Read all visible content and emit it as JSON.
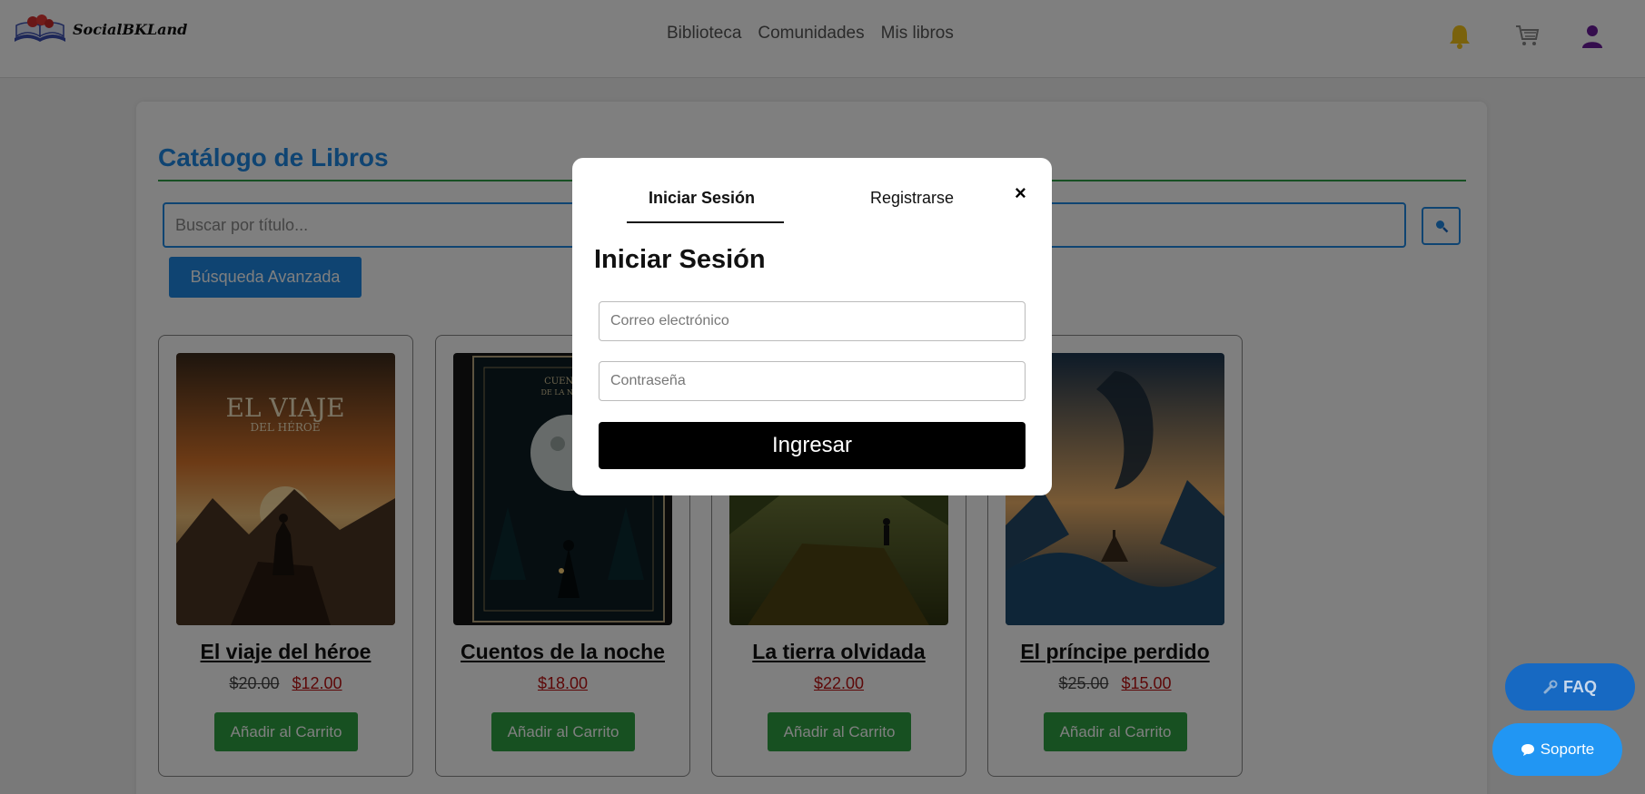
{
  "header": {
    "logo_text": "SocialBKLand",
    "nav": [
      "Biblioteca",
      "Comunidades",
      "Mis libros"
    ]
  },
  "catalog": {
    "title": "Catálogo de Libros",
    "search_placeholder": "Buscar por título...",
    "advanced_search_label": "Búsqueda Avanzada",
    "add_to_cart_label": "Añadir al Carrito"
  },
  "books": [
    {
      "title": "El viaje del héroe",
      "old_price": "$20.00",
      "price": "$12.00"
    },
    {
      "title": "Cuentos de la noche",
      "old_price": "",
      "price": "$18.00"
    },
    {
      "title": "La tierra olvidada",
      "old_price": "",
      "price": "$22.00"
    },
    {
      "title": "El príncipe perdido",
      "old_price": "$25.00",
      "price": "$15.00"
    }
  ],
  "covers": [
    {
      "cover_text": "EL VIAJE",
      "cover_subtext": "DEL HÉROE"
    },
    {
      "cover_text": "CUENTOS",
      "cover_subtext": "DE LA NOCHE"
    },
    {
      "cover_text": "",
      "cover_subtext": ""
    },
    {
      "cover_text": "",
      "cover_subtext": ""
    }
  ],
  "floating": {
    "faq_label": "FAQ",
    "support_label": "Soporte"
  },
  "modal": {
    "tab_login": "Iniciar Sesión",
    "tab_register": "Registrarse",
    "close_label": "×",
    "heading": "Iniciar Sesión",
    "email_placeholder": "Correo electrónico",
    "password_placeholder": "Contraseña",
    "submit_label": "Ingresar"
  },
  "colors": {
    "accent": "#1e88e5",
    "success": "#2ea043",
    "overlay": "rgba(0,0,0,0.5)",
    "price_sale": "#b11111"
  }
}
